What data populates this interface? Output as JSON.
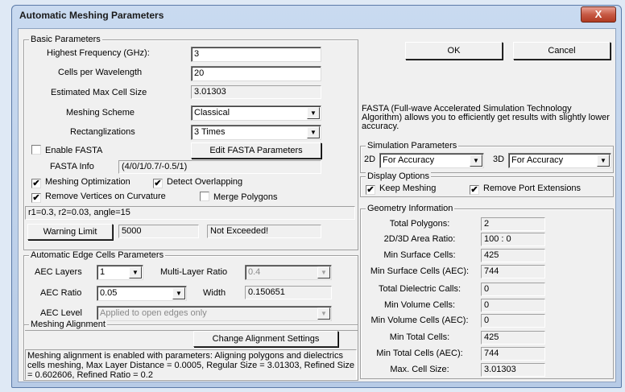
{
  "window": {
    "title": "Automatic Meshing Parameters",
    "close_glyph": "X"
  },
  "buttons": {
    "ok": "OK",
    "cancel": "Cancel"
  },
  "basic": {
    "legend": "Basic Parameters",
    "highest_freq_label": "Highest Frequency (GHz):",
    "highest_freq_value": "3",
    "cells_per_wl_label": "Cells per Wavelength",
    "cells_per_wl_value": "20",
    "est_max_cell_label": "Estimated Max Cell Size",
    "est_max_cell_value": "3.01303",
    "meshing_scheme_label": "Meshing Scheme",
    "meshing_scheme_value": "Classical",
    "rect_label": "Rectanglizations",
    "rect_value": "3 Times",
    "enable_fasta_label": "Enable FASTA",
    "enable_fasta_checked": false,
    "edit_fasta_button": "Edit FASTA Parameters",
    "fasta_info_label": "FASTA Info",
    "fasta_info_value": "(4/0/1/0.7/-0.5/1)",
    "mesh_opt_label": "Meshing Optimization",
    "mesh_opt_checked": true,
    "detect_overlap_label": "Detect Overlapping",
    "detect_overlap_checked": true,
    "remove_vertices_label": "Remove Vertices on Curvature",
    "remove_vertices_checked": true,
    "merge_polygons_label": "Merge Polygons",
    "merge_polygons_checked": false,
    "curvature_text": "r1=0.3, r2=0.03, angle=15",
    "warning_button": "Warning Limit",
    "warning_value": "5000",
    "warning_status": "Not Exceeded!"
  },
  "aec": {
    "legend": "Automatic Edge Cells Parameters",
    "layers_label": "AEC Layers",
    "layers_value": "1",
    "multi_ratio_label": "Multi-Layer Ratio",
    "multi_ratio_value": "0.4",
    "ratio_label": "AEC Ratio",
    "ratio_value": "0.05",
    "width_label": "Width",
    "width_value": "0.150651",
    "level_label": "AEC Level",
    "level_value": "Applied to open edges only"
  },
  "alignment": {
    "legend": "Meshing Alignment",
    "change_button": "Change Alignment Settings",
    "description": "Meshing alignment is enabled with parameters: Aligning polygons and dielectrics cells meshing, Max Layer Distance = 0.0005, Regular Size = 3.01303, Refined Size = 0.602606, Refined Ratio = 0.2"
  },
  "fasta_desc": "FASTA (Full-wave Accelerated Simulation Technology Algorithm) allows you to efficiently get results with slightly lower accuracy.",
  "simulation": {
    "legend": "Simulation Parameters",
    "label_2d": "2D",
    "value_2d": "For Accuracy",
    "label_3d": "3D",
    "value_3d": "For Accuracy"
  },
  "display": {
    "legend": "Display Options",
    "keep_meshing_label": "Keep Meshing",
    "keep_meshing_checked": true,
    "remove_port_label": "Remove Port Extensions",
    "remove_port_checked": true
  },
  "geometry": {
    "legend": "Geometry Information",
    "rows": [
      {
        "label": "Total Polygons:",
        "value": "2"
      },
      {
        "label": "2D/3D Area Ratio:",
        "value": "100 : 0"
      },
      {
        "label": "Min Surface Cells:",
        "value": "425"
      },
      {
        "label": "Min Surface Cells (AEC):",
        "value": "744"
      },
      {
        "label": "Total Dielectric Calls:",
        "value": "0"
      },
      {
        "label": "Min Volume Cells:",
        "value": "0"
      },
      {
        "label": "Min Volume Cells (AEC):",
        "value": "0"
      },
      {
        "label": "Min Total Cells:",
        "value": "425"
      },
      {
        "label": "Min Total Cells (AEC):",
        "value": "744"
      },
      {
        "label": "Max. Cell Size:",
        "value": "3.01303"
      }
    ]
  },
  "icons": {
    "dropdown": "▼",
    "check": "✔"
  }
}
